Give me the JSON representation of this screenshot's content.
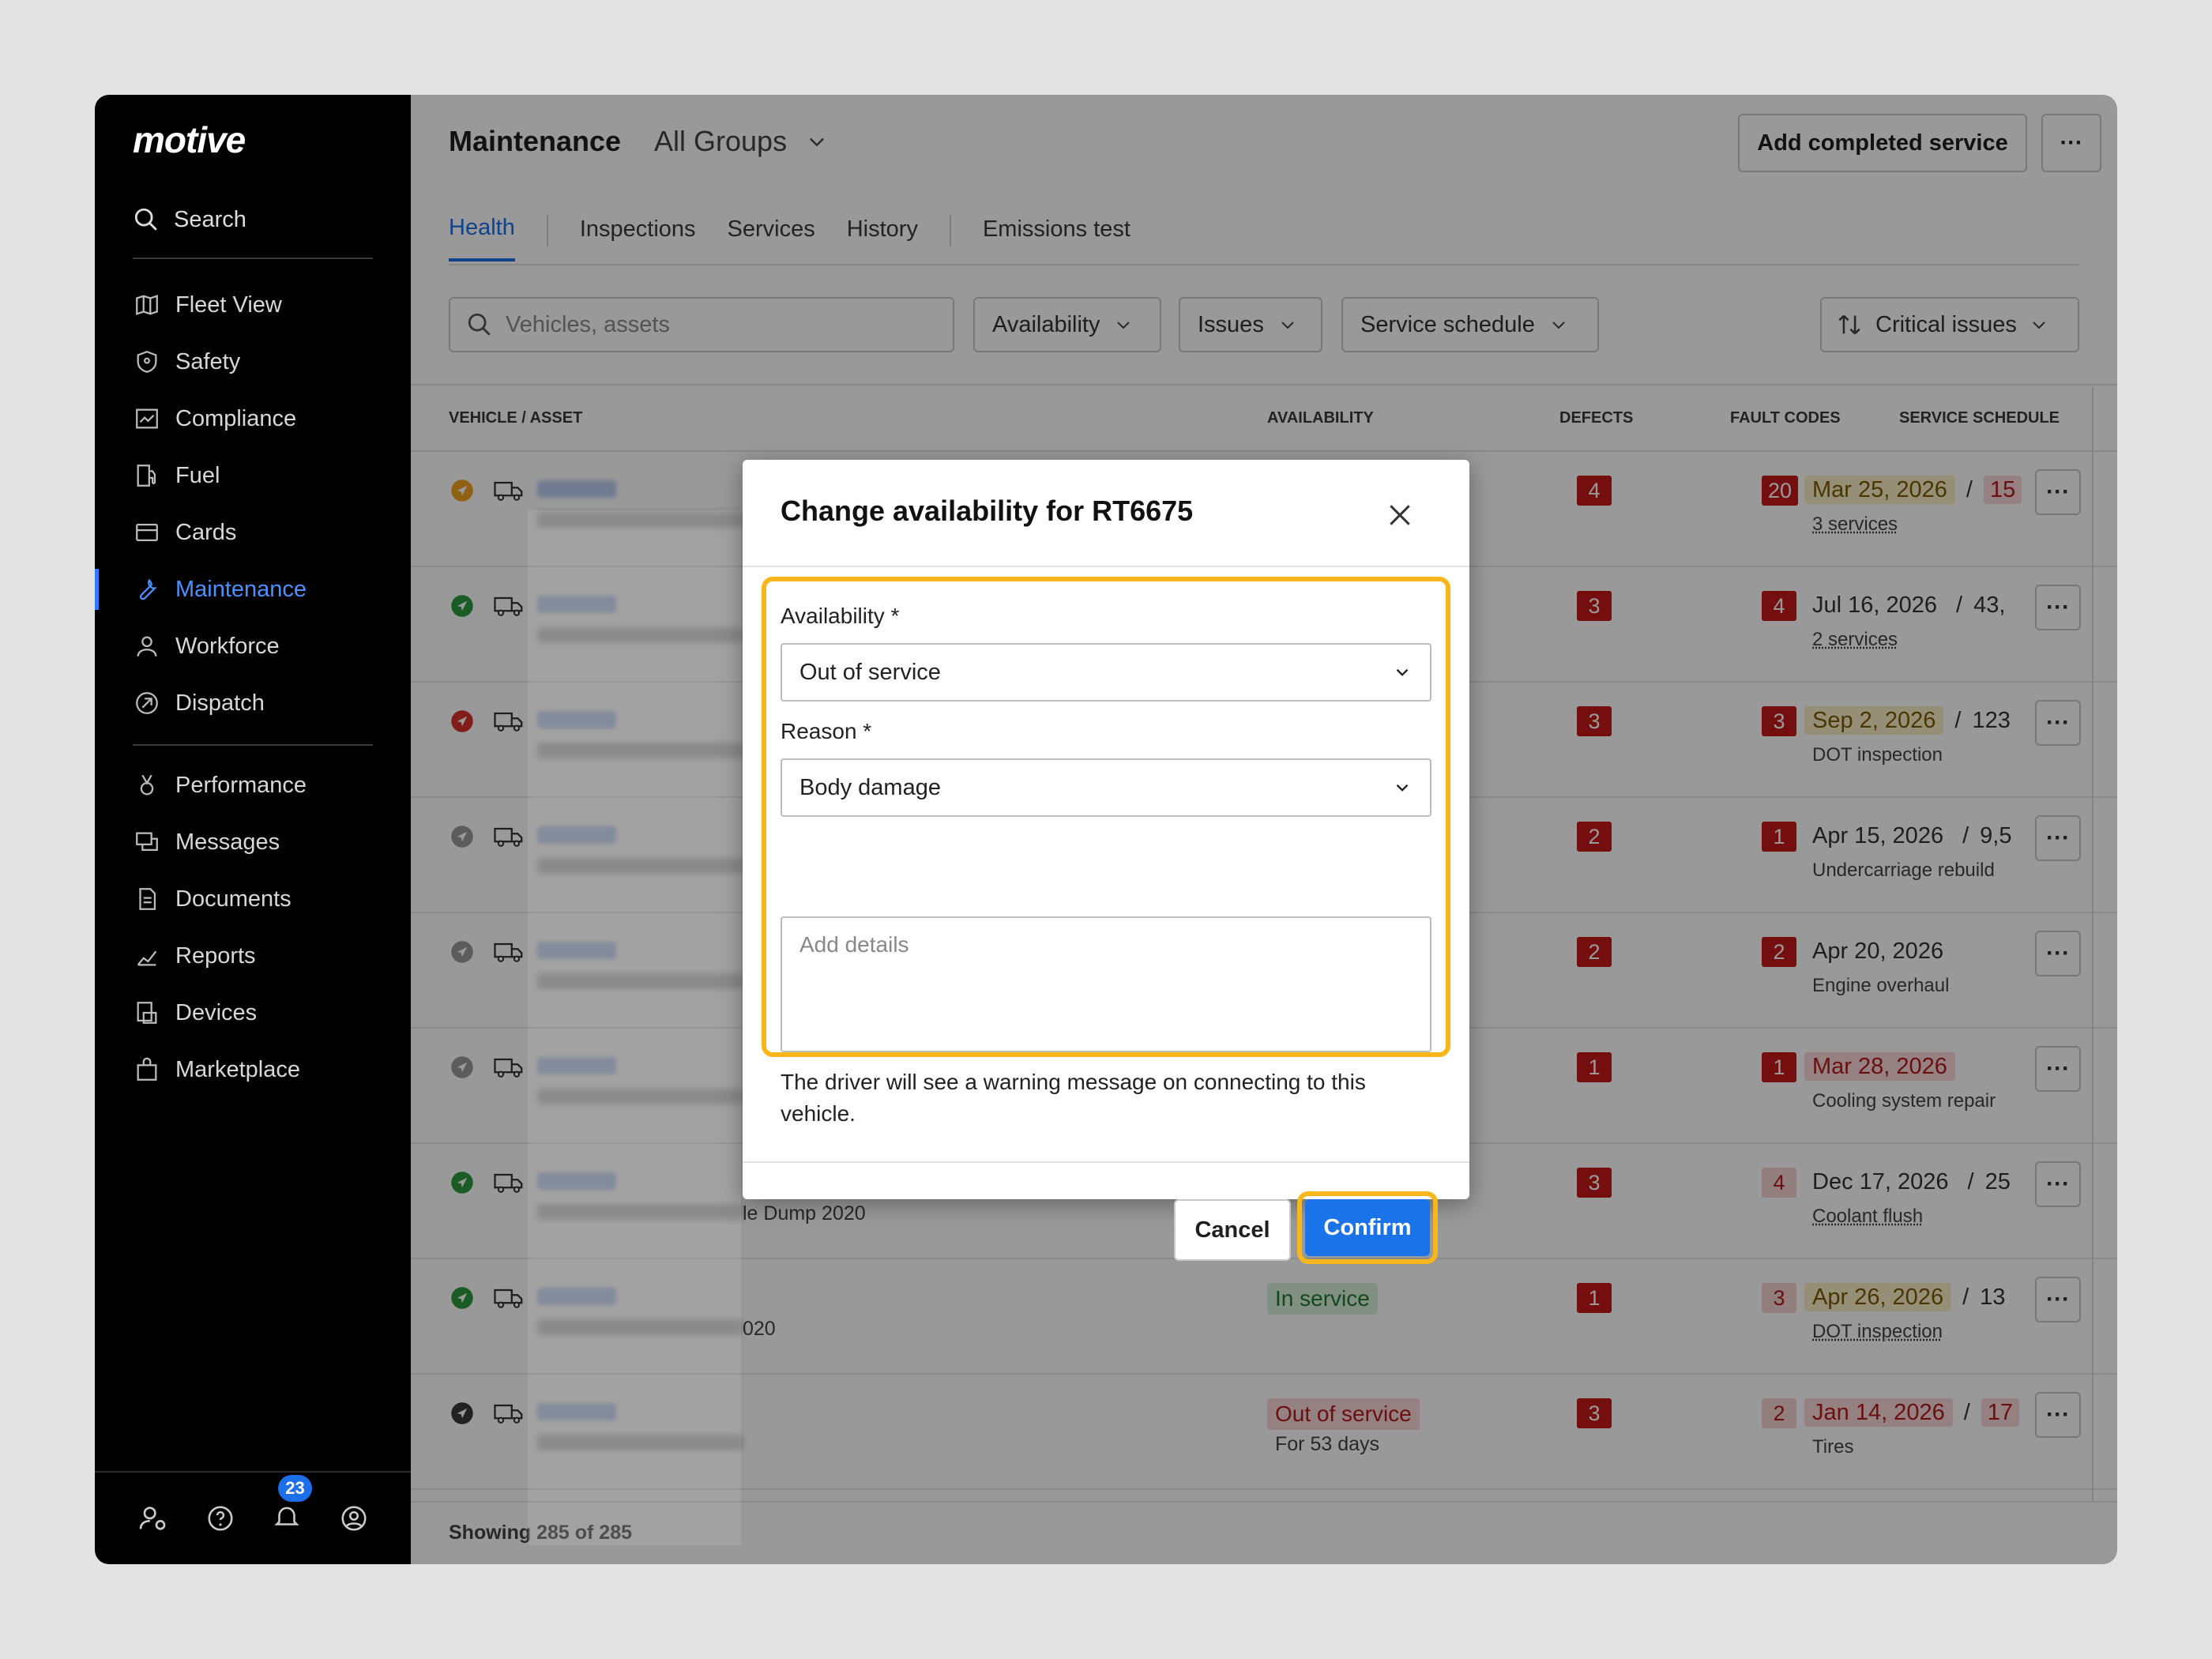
{
  "sidebar": {
    "logo": "motive",
    "search_label": "Search",
    "items_primary": [
      {
        "label": "Fleet View",
        "icon": "map-icon"
      },
      {
        "label": "Safety",
        "icon": "shield-icon"
      },
      {
        "label": "Compliance",
        "icon": "compliance-icon"
      },
      {
        "label": "Fuel",
        "icon": "fuel-icon"
      },
      {
        "label": "Cards",
        "icon": "card-icon"
      },
      {
        "label": "Maintenance",
        "icon": "wrench-icon",
        "active": true
      },
      {
        "label": "Workforce",
        "icon": "person-icon"
      },
      {
        "label": "Dispatch",
        "icon": "dispatch-icon"
      }
    ],
    "items_secondary": [
      {
        "label": "Performance",
        "icon": "medal-icon"
      },
      {
        "label": "Messages",
        "icon": "messages-icon"
      },
      {
        "label": "Documents",
        "icon": "document-icon"
      },
      {
        "label": "Reports",
        "icon": "chart-icon"
      },
      {
        "label": "Devices",
        "icon": "devices-icon"
      },
      {
        "label": "Marketplace",
        "icon": "bag-icon"
      }
    ],
    "notification_count": "23"
  },
  "header": {
    "title": "Maintenance",
    "group": "All Groups",
    "add_service_label": "Add completed service",
    "more_label": "···"
  },
  "tabs": [
    "Health",
    "Inspections",
    "Services",
    "History",
    "Emissions test"
  ],
  "filters": {
    "search_placeholder": "Vehicles, assets",
    "availability": "Availability",
    "issues": "Issues",
    "service_schedule": "Service schedule",
    "sort": "Critical issues"
  },
  "table": {
    "columns": [
      "VEHICLE / ASSET",
      "AVAILABILITY",
      "DEFECTS",
      "FAULT CODES",
      "SERVICE SCHEDULE"
    ],
    "rows": [
      {
        "status_color": "#f0a020",
        "subtitle": "",
        "availability": "",
        "availability_sub": "",
        "defects": "4",
        "fault_codes": "20",
        "fault_style": "solid",
        "sched_date": "Mar 25, 2026",
        "sched_date_style": "yellow",
        "sched_extra": "15",
        "sched_extra_style": "red",
        "sched_sub": "3 services"
      },
      {
        "status_color": "#2a9a3c",
        "subtitle": "",
        "availability": "",
        "availability_sub": "",
        "defects": "3",
        "fault_codes": "4",
        "fault_style": "solid",
        "sched_date": "Jul 16, 2026",
        "sched_date_style": "plain",
        "sched_extra": "43,",
        "sched_extra_style": "plain",
        "sched_sub": "2 services"
      },
      {
        "status_color": "#d8322a",
        "subtitle": "",
        "availability": "",
        "availability_sub": "",
        "defects": "3",
        "fault_codes": "3",
        "fault_style": "solid",
        "sched_date": "Sep 2, 2026",
        "sched_date_style": "yellow",
        "sched_extra": "123",
        "sched_extra_style": "plain",
        "sched_sub": "DOT inspection"
      },
      {
        "status_color": "#9a9a9a",
        "subtitle": "",
        "availability": "",
        "availability_sub": "",
        "defects": "2",
        "fault_codes": "1",
        "fault_style": "solid",
        "sched_date": "Apr 15, 2026",
        "sched_date_style": "plain",
        "sched_extra": "9,5",
        "sched_extra_style": "plain",
        "sched_sub": "Undercarriage rebuild"
      },
      {
        "status_color": "#9a9a9a",
        "subtitle": "",
        "availability": "",
        "availability_sub": "",
        "defects": "2",
        "fault_codes": "2",
        "fault_style": "solid",
        "sched_date": "Apr 20, 2026",
        "sched_date_style": "plain",
        "sched_extra": "",
        "sched_extra_style": "plain",
        "sched_sub": "Engine overhaul"
      },
      {
        "status_color": "#9a9a9a",
        "subtitle": "",
        "availability": "",
        "availability_sub": "",
        "defects": "1",
        "fault_codes": "1",
        "fault_style": "solid",
        "sched_date": "Mar 28, 2026",
        "sched_date_style": "red",
        "sched_extra": "",
        "sched_extra_style": "plain",
        "sched_sub": "Cooling system repair"
      },
      {
        "status_color": "#2a9a3c",
        "subtitle": "le Dump 2020",
        "availability": "",
        "availability_sub": "",
        "defects": "3",
        "fault_codes": "4",
        "fault_style": "light",
        "sched_date": "Dec 17, 2026",
        "sched_date_style": "plain",
        "sched_extra": "25",
        "sched_extra_style": "plain",
        "sched_sub": "Coolant flush"
      },
      {
        "status_color": "#2a9a3c",
        "subtitle": "020",
        "availability": "In service",
        "availability_sub": "",
        "defects": "1",
        "fault_codes": "3",
        "fault_style": "light",
        "sched_date": "Apr 26, 2026",
        "sched_date_style": "yellow",
        "sched_extra": "13",
        "sched_extra_style": "plain",
        "sched_sub": "DOT inspection"
      },
      {
        "status_color": "#3a3a3a",
        "subtitle": "",
        "availability": "Out of service",
        "availability_sub": "For 53 days",
        "defects": "3",
        "fault_codes": "2",
        "fault_style": "light",
        "sched_date": "Jan 14, 2026",
        "sched_date_style": "red",
        "sched_extra": "17",
        "sched_extra_style": "red",
        "sched_sub": "Tires"
      }
    ],
    "footer": "Showing 285 of 285"
  },
  "modal": {
    "title": "Change availability for RT6675",
    "availability_label": "Availability *",
    "availability_value": "Out of service",
    "reason_label": "Reason *",
    "reason_value": "Body damage",
    "details_placeholder": "Add details",
    "note": "The driver will see a warning message on connecting to this vehicle.",
    "cancel_label": "Cancel",
    "confirm_label": "Confirm"
  },
  "colors": {
    "accent": "#1a73e8",
    "highlight": "#f8b61a",
    "sidebar_bg": "#000000",
    "defect_red": "#c41a1a"
  }
}
